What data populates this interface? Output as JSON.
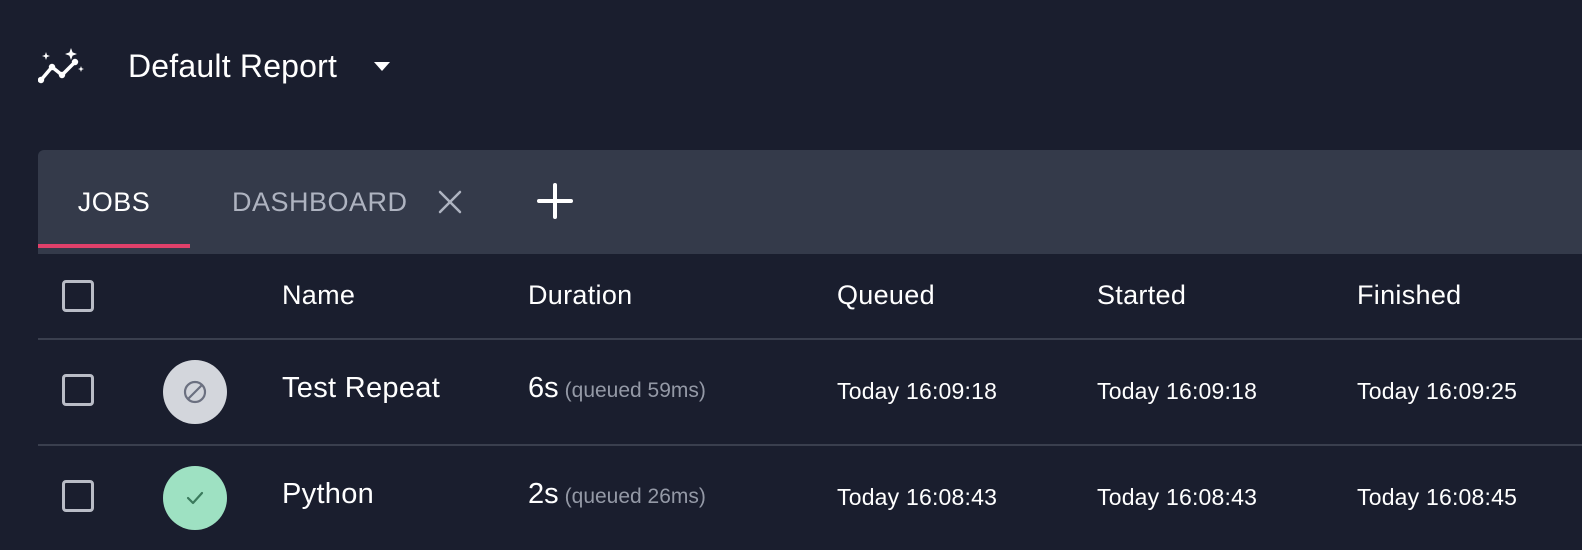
{
  "header": {
    "report_title": "Default Report"
  },
  "tabs": [
    {
      "label": "JOBS",
      "active": true
    },
    {
      "label": "DASHBOARD",
      "active": false,
      "closable": true
    }
  ],
  "table": {
    "columns": [
      "Name",
      "Duration",
      "Queued",
      "Started",
      "Finished"
    ],
    "rows": [
      {
        "status": "cancelled",
        "status_icon": "cancel-icon",
        "name": "Test Repeat",
        "duration": "6s",
        "queued_note": "(queued 59ms)",
        "queued": "Today 16:09:18",
        "started": "Today 16:09:18",
        "finished": "Today 16:09:25"
      },
      {
        "status": "success",
        "status_icon": "check-icon",
        "name": "Python",
        "duration": "2s",
        "queued_note": "(queued 26ms)",
        "queued": "Today 16:08:43",
        "started": "Today 16:08:43",
        "finished": "Today 16:08:45"
      }
    ]
  },
  "colors": {
    "background": "#1a1e2e",
    "tabbar": "#343a4a",
    "accent": "#e0406a",
    "success": "#9ee1c2",
    "cancelled": "#d3d6dc"
  }
}
